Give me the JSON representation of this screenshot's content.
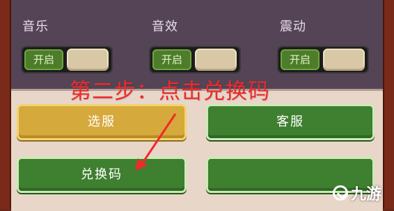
{
  "settings": {
    "music_label": "音乐",
    "sfx_label": "音效",
    "vibration_label": "震动",
    "toggle_on_text": "开启"
  },
  "buttons": {
    "select_server": "选服",
    "customer_service": "客服",
    "redeem_code": "兑换码",
    "unlabeled": ""
  },
  "annotation": {
    "text": "第二步：点击兑换码",
    "color": "#ef2a2a"
  },
  "watermark": {
    "text": "九游",
    "icon": "jiuyou-logo-icon"
  },
  "colors": {
    "top_panel": "#544456",
    "bottom_panel": "#e8d6c9",
    "toggle_on": "#4d7d2b",
    "btn_yellow": "#d6a93c",
    "btn_green": "#3f7f30"
  }
}
